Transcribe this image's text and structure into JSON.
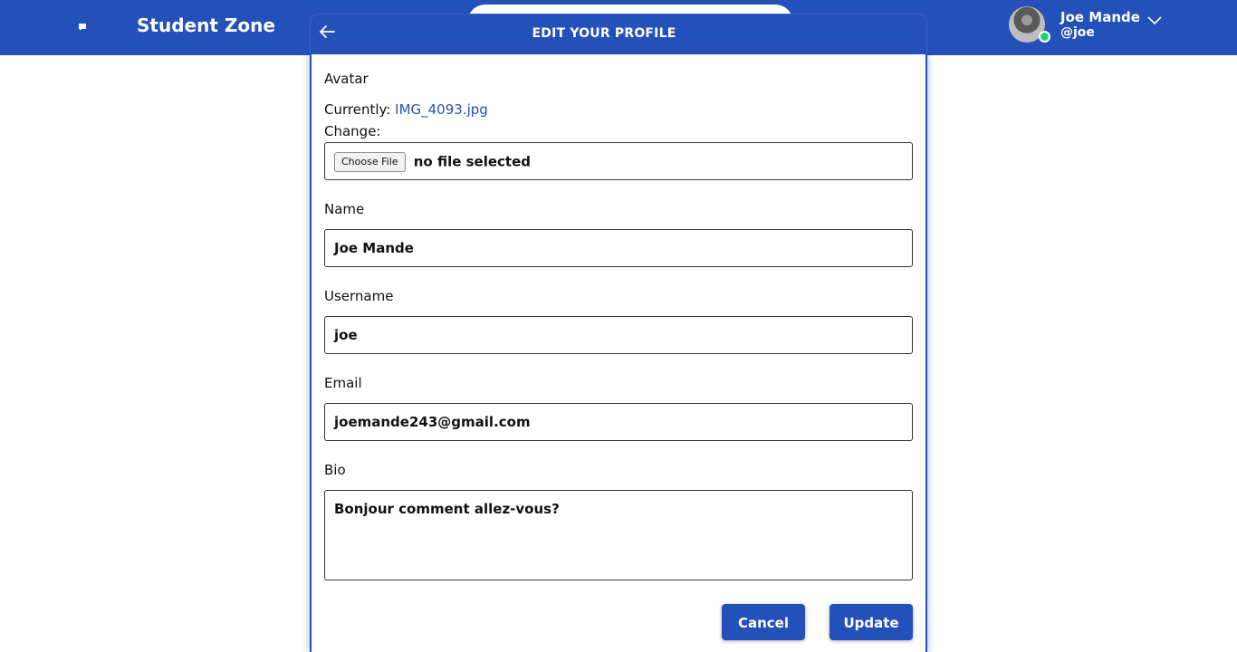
{
  "header": {
    "brand": "Student Zone",
    "user": {
      "name": "Joe Mande",
      "handle": "@joe"
    }
  },
  "card": {
    "title": "EDIT YOUR PROFILE"
  },
  "form": {
    "avatar": {
      "label": "Avatar",
      "currently_label": "Currently:",
      "current_file": "IMG_4093.jpg",
      "change_label": "Change:",
      "file_button": "Choose File",
      "file_status": "no file selected"
    },
    "name": {
      "label": "Name",
      "value": "Joe Mande"
    },
    "username": {
      "label": "Username",
      "value": "joe"
    },
    "email": {
      "label": "Email",
      "value": "joemande243@gmail.com"
    },
    "bio": {
      "label": "Bio",
      "value": "Bonjour comment allez-vous?"
    }
  },
  "actions": {
    "cancel": "Cancel",
    "update": "Update"
  },
  "colors": {
    "primary": "#2450b9",
    "online": "#22d36b"
  },
  "icons": [
    "chat-icon",
    "back-arrow-icon",
    "chevron-down-icon"
  ]
}
